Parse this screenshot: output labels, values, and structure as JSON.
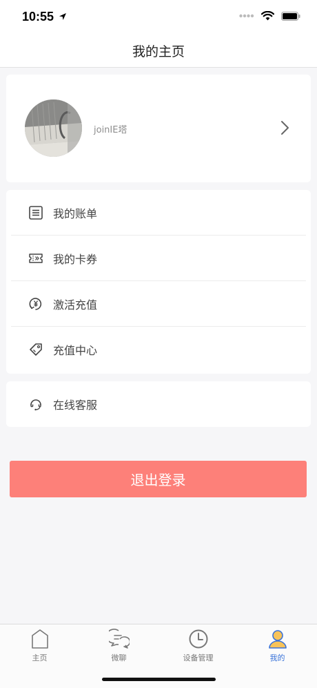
{
  "status_bar": {
    "time": "10:55"
  },
  "nav": {
    "title": "我的主页"
  },
  "profile": {
    "username": "joinIE塔"
  },
  "menu": {
    "items": [
      {
        "label": "我的账单",
        "icon": "bill-list-icon"
      },
      {
        "label": "我的卡券",
        "icon": "ticket-icon"
      },
      {
        "label": "激活充值",
        "icon": "yen-refresh-icon"
      },
      {
        "label": "充值中心",
        "icon": "price-tag-icon"
      }
    ],
    "service": {
      "label": "在线客服",
      "icon": "headset-icon"
    }
  },
  "logout": {
    "label": "退出登录"
  },
  "colors": {
    "logout_bg": "#fd8079",
    "active_tab": "#3a73d9"
  },
  "tabs": [
    {
      "label": "主页",
      "icon": "home-icon",
      "active": false
    },
    {
      "label": "微聊",
      "icon": "chat-icon",
      "active": false
    },
    {
      "label": "设备管理",
      "icon": "clock-icon",
      "active": false
    },
    {
      "label": "我的",
      "icon": "user-icon",
      "active": true
    }
  ]
}
